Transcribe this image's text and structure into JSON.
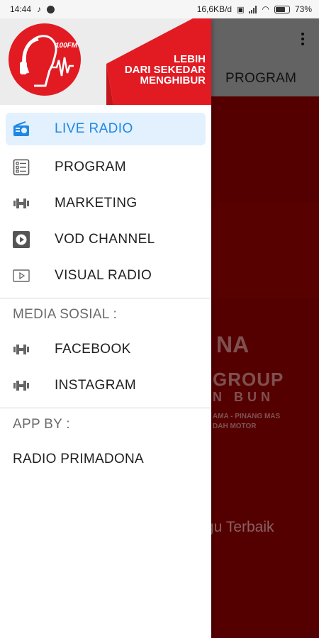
{
  "status_bar": {
    "time": "14:44",
    "net_speed": "16,6KB/d",
    "battery": "73%",
    "battery_level": 0.73
  },
  "background_app": {
    "tab_label": "PROGRAM",
    "overflow_icon": "more-vert-icon",
    "banner_text_1": "NA",
    "banner_text_2": "GROUP",
    "banner_text_3": "N BUN",
    "banner_text_4": "AMA - PINANG MAS",
    "banner_text_5": "DAH MOTOR",
    "tagline_partial": "gu Terbaik",
    "content_color": "#7a0000"
  },
  "drawer": {
    "logo_text": "100FM",
    "tagline": [
      "LEBIH",
      "DARI SEKEDAR",
      "MENGHIBUR"
    ],
    "brand_color": "#e21b23",
    "accent_color": "#1e88e5",
    "menu_items": [
      {
        "label": "LIVE RADIO",
        "icon": "radio-icon",
        "active": true
      },
      {
        "label": "PROGRAM",
        "icon": "schedule-list-icon",
        "active": false
      },
      {
        "label": "MARKETING",
        "icon": "dumbbell-icon",
        "active": false
      },
      {
        "label": "VOD CHANNEL",
        "icon": "play-box-icon",
        "active": false
      },
      {
        "label": "VISUAL RADIO",
        "icon": "play-outline-icon",
        "active": false
      }
    ],
    "social_section_title": "MEDIA SOSIAL :",
    "social_items": [
      {
        "label": "FACEBOOK",
        "icon": "dumbbell-icon"
      },
      {
        "label": "INSTAGRAM",
        "icon": "dumbbell-icon"
      }
    ],
    "app_by_title": "APP BY :",
    "app_by_value": "RADIO PRIMADONA"
  }
}
